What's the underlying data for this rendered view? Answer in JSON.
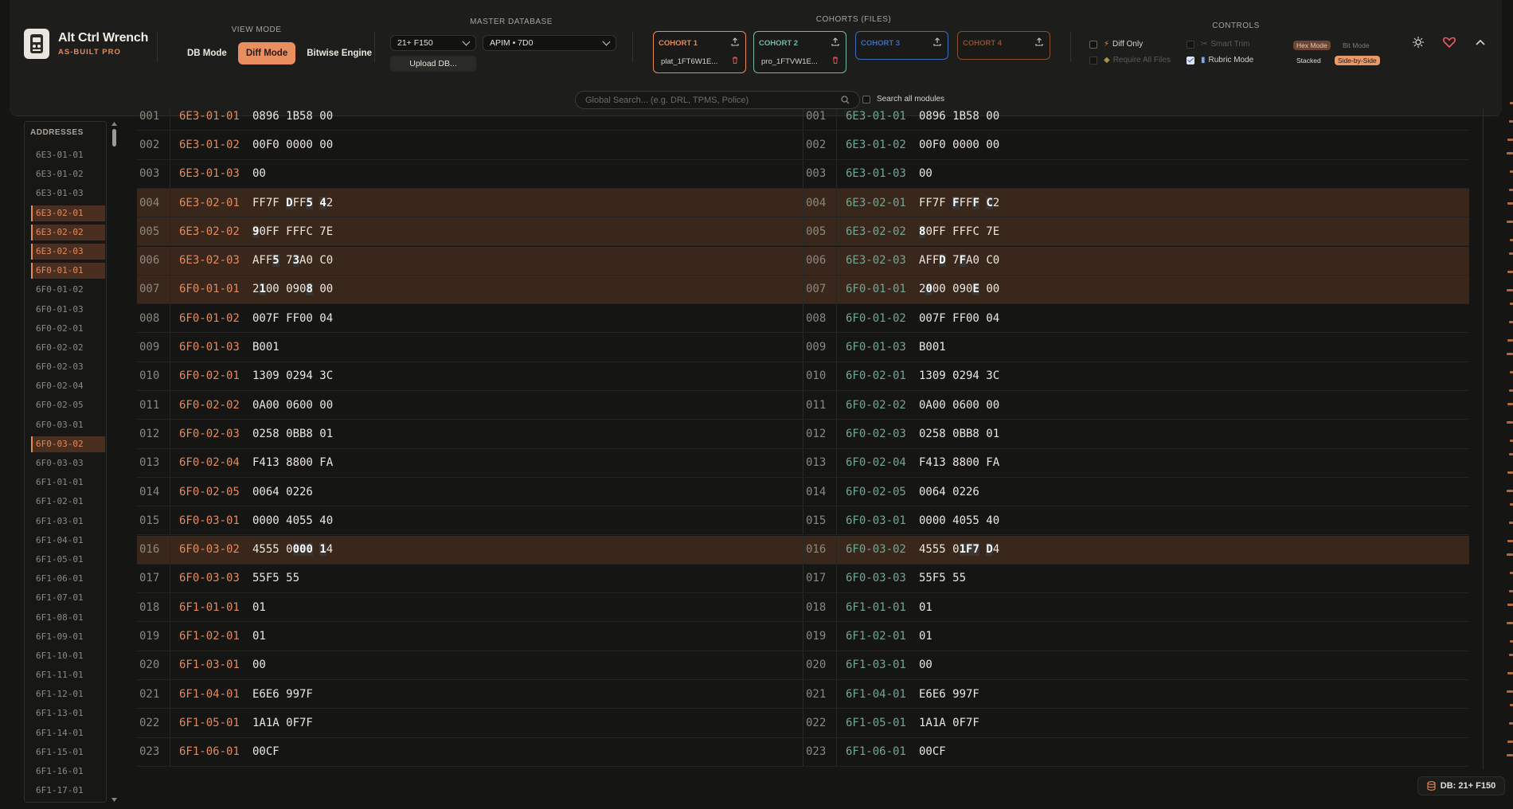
{
  "brand": {
    "title": "Alt Ctrl Wrench",
    "subtitle": "AS-BUILT PRO"
  },
  "view_mode": {
    "title": "VIEW MODE",
    "buttons": [
      "DB Mode",
      "Diff Mode",
      "Bitwise Engine"
    ],
    "active": "Diff Mode"
  },
  "master_db": {
    "title": "MASTER DATABASE",
    "vehicle": "21+ F150",
    "module": "APIM • 7D0",
    "upload_label": "Upload DB..."
  },
  "cohorts": {
    "title": "COHORTS (FILES)",
    "items": [
      {
        "label": "COHORT 1",
        "file": "plat_1FT6W1E...",
        "color": "#e58a5a"
      },
      {
        "label": "COHORT 2",
        "file": "pro_1FTVW1E...",
        "color": "#78b7a6"
      },
      {
        "label": "COHORT 3",
        "file": "",
        "color": "#3f6bb8"
      },
      {
        "label": "COHORT 4",
        "file": "",
        "color": "#8a4f33"
      }
    ]
  },
  "controls": {
    "title": "CONTROLS",
    "diff_only": "Diff Only",
    "smart_trim": "Smart Trim",
    "require_all": "Require All Files",
    "rubric_mode": "Rubric Mode",
    "hex_mode": "Hex Mode",
    "bit_mode": "Bit Mode",
    "stacked": "Stacked",
    "side_by_side": "Side-by-Side"
  },
  "search": {
    "placeholder": "Global Search... (e.g. DRL, TPMS, Police)",
    "all_modules": "Search all modules"
  },
  "sidebar": {
    "title": "ADDRESSES",
    "items": [
      "6E3-01-01",
      "6E3-01-02",
      "6E3-01-03",
      "6E3-02-01",
      "6E3-02-02",
      "6E3-02-03",
      "6F0-01-01",
      "6F0-01-02",
      "6F0-01-03",
      "6F0-02-01",
      "6F0-02-02",
      "6F0-02-03",
      "6F0-02-04",
      "6F0-02-05",
      "6F0-03-01",
      "6F0-03-02",
      "6F0-03-03",
      "6F1-01-01",
      "6F1-02-01",
      "6F1-03-01",
      "6F1-04-01",
      "6F1-05-01",
      "6F1-06-01",
      "6F1-07-01",
      "6F1-08-01",
      "6F1-09-01",
      "6F1-10-01",
      "6F1-11-01",
      "6F1-12-01",
      "6F1-13-01",
      "6F1-14-01",
      "6F1-15-01",
      "6F1-16-01",
      "6F1-17-01"
    ],
    "changed": [
      "6E3-02-01",
      "6E3-02-02",
      "6E3-02-03",
      "6F0-01-01",
      "6F0-03-02"
    ]
  },
  "rows": [
    {
      "n": "001",
      "addr": "6E3-01-01",
      "left": "0896 1B58 00",
      "right": "0896 1B58 00",
      "changed": false
    },
    {
      "n": "002",
      "addr": "6E3-01-02",
      "left": "00F0 0000 00",
      "right": "00F0 0000 00",
      "changed": false
    },
    {
      "n": "003",
      "addr": "6E3-01-03",
      "left": "00",
      "right": "00",
      "changed": false
    },
    {
      "n": "004",
      "addr": "6E3-02-01",
      "left": "FF7F DFF5 42",
      "right": "FF7F FFFF C2",
      "changed": true
    },
    {
      "n": "005",
      "addr": "6E3-02-02",
      "left": "90FF FFFC 7E",
      "right": "80FF FFFC 7E",
      "changed": true
    },
    {
      "n": "006",
      "addr": "6E3-02-03",
      "left": "AFF5 73A0 C0",
      "right": "AFFD 7FA0 C0",
      "changed": true
    },
    {
      "n": "007",
      "addr": "6F0-01-01",
      "left": "2100 0908 00",
      "right": "2000 090E 00",
      "changed": true
    },
    {
      "n": "008",
      "addr": "6F0-01-02",
      "left": "007F FF00 04",
      "right": "007F FF00 04",
      "changed": false
    },
    {
      "n": "009",
      "addr": "6F0-01-03",
      "left": "B001",
      "right": "B001",
      "changed": false
    },
    {
      "n": "010",
      "addr": "6F0-02-01",
      "left": "1309 0294 3C",
      "right": "1309 0294 3C",
      "changed": false
    },
    {
      "n": "011",
      "addr": "6F0-02-02",
      "left": "0A00 0600 00",
      "right": "0A00 0600 00",
      "changed": false
    },
    {
      "n": "012",
      "addr": "6F0-02-03",
      "left": "0258 0BB8 01",
      "right": "0258 0BB8 01",
      "changed": false
    },
    {
      "n": "013",
      "addr": "6F0-02-04",
      "left": "F413 8800 FA",
      "right": "F413 8800 FA",
      "changed": false
    },
    {
      "n": "014",
      "addr": "6F0-02-05",
      "left": "0064 0226",
      "right": "0064 0226",
      "changed": false
    },
    {
      "n": "015",
      "addr": "6F0-03-01",
      "left": "0000 4055 40",
      "right": "0000 4055 40",
      "changed": false
    },
    {
      "n": "016",
      "addr": "6F0-03-02",
      "left": "4555 0000 14",
      "right": "4555 01F7 D4",
      "changed": true
    },
    {
      "n": "017",
      "addr": "6F0-03-03",
      "left": "55F5 55",
      "right": "55F5 55",
      "changed": false
    },
    {
      "n": "018",
      "addr": "6F1-01-01",
      "left": "01",
      "right": "01",
      "changed": false
    },
    {
      "n": "019",
      "addr": "6F1-02-01",
      "left": "01",
      "right": "01",
      "changed": false
    },
    {
      "n": "020",
      "addr": "6F1-03-01",
      "left": "00",
      "right": "00",
      "changed": false
    },
    {
      "n": "021",
      "addr": "6F1-04-01",
      "left": "E6E6 997F",
      "right": "E6E6 997F",
      "changed": false
    },
    {
      "n": "022",
      "addr": "6F1-05-01",
      "left": "1A1A 0F7F",
      "right": "1A1A 0F7F",
      "changed": false
    },
    {
      "n": "023",
      "addr": "6F1-06-01",
      "left": "00CF",
      "right": "00CF",
      "changed": false
    }
  ],
  "db_badge": "DB: 21+ F150"
}
